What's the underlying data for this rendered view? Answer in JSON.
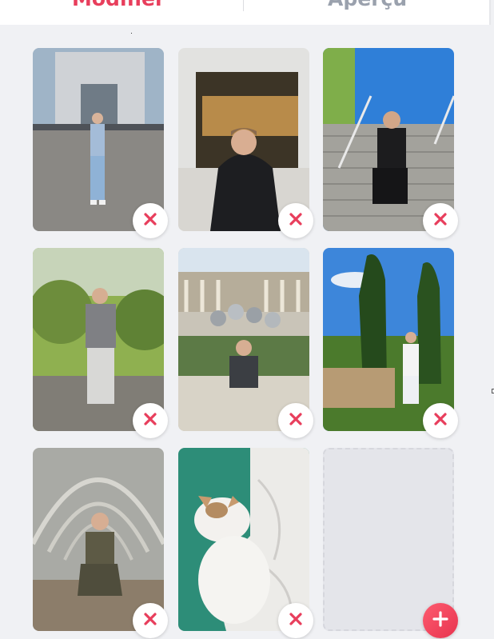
{
  "tabs": [
    {
      "label": "Modifier",
      "active": true
    },
    {
      "label": "Aperçu",
      "active": false
    }
  ],
  "colors": {
    "accent": "#e83e5c",
    "inactive_tab": "#9aa1ad",
    "background": "#f0f1f4"
  },
  "photos": [
    {
      "subject": "man-at-monument",
      "icon": "close-icon"
    },
    {
      "subject": "man-in-window-seat",
      "icon": "close-icon"
    },
    {
      "subject": "man-on-stairs",
      "icon": "close-icon"
    },
    {
      "subject": "man-in-park",
      "icon": "close-icon"
    },
    {
      "subject": "man-by-sphere-fountain",
      "icon": "close-icon"
    },
    {
      "subject": "man-in-garden",
      "icon": "close-icon"
    },
    {
      "subject": "man-in-glass-tunnel",
      "icon": "close-icon"
    },
    {
      "subject": "white-cat-on-bed",
      "icon": "close-icon"
    }
  ],
  "empty_slot": {
    "icon": "plus-icon"
  }
}
